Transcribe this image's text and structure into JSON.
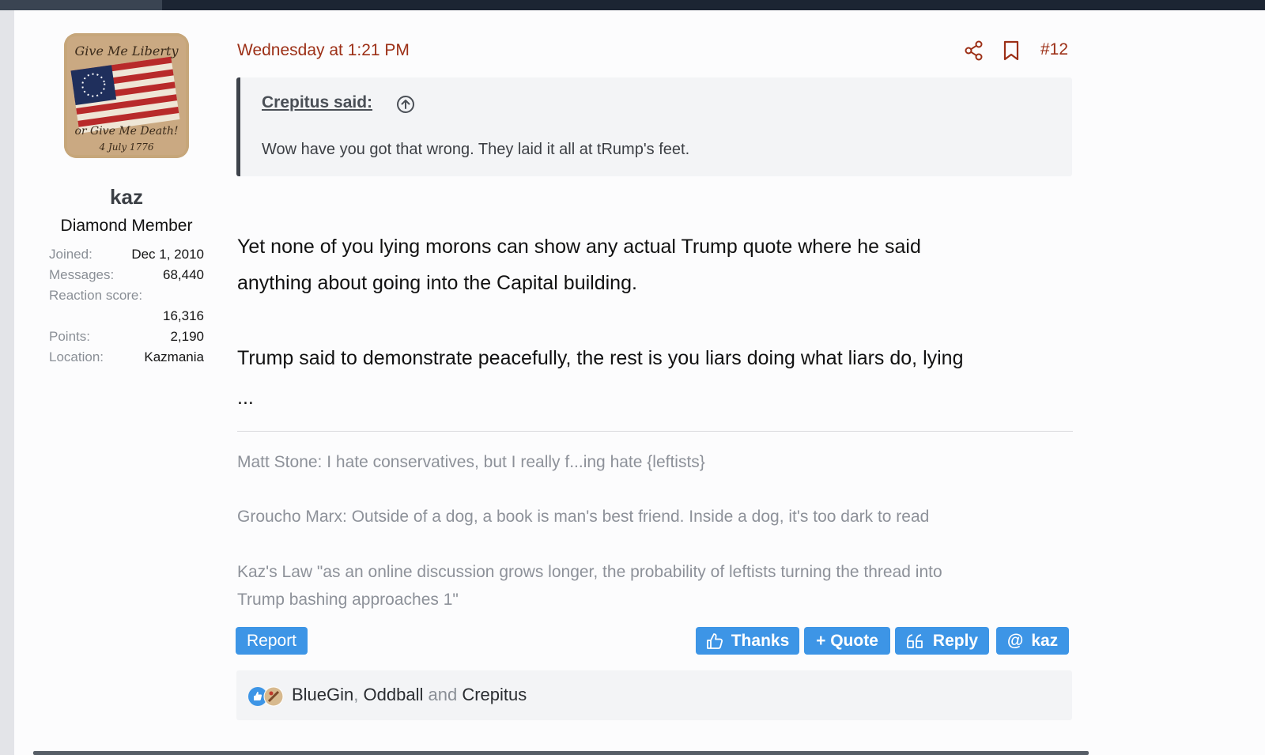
{
  "user": {
    "name": "kaz",
    "title": "Diamond Member",
    "avatar_text_top": "Give Me Liberty",
    "avatar_text_bottom": "or Give Me Death!",
    "avatar_date": "4 July 1776",
    "stats": [
      {
        "label": "Joined:",
        "value": "Dec 1, 2010"
      },
      {
        "label": "Messages:",
        "value": "68,440"
      },
      {
        "label": "Reaction score:",
        "value": "16,316"
      },
      {
        "label": "Points:",
        "value": "2,190"
      },
      {
        "label": "Location:",
        "value": "Kazmania"
      }
    ]
  },
  "post": {
    "date": "Wednesday at 1:21 PM",
    "number": "#12",
    "icons": {
      "share": "share-icon",
      "bookmark": "bookmark-icon"
    },
    "quote": {
      "attribution": "Crepitus said:",
      "text": "Wow have you got that wrong. They laid it all at tRump's feet."
    },
    "body": [
      "Yet none of you lying morons can show any actual Trump quote where he said",
      "anything about going into the Capital building.",
      "Trump said to demonstrate peacefully, the rest is you liars doing what liars do, lying",
      "..."
    ],
    "signature": [
      "Matt Stone: I hate conservatives, but I really f...ing hate {leftists}",
      "Groucho Marx: Outside of a dog, a book is man's best friend. Inside a dog, it's too dark to read",
      "Kaz's Law \"as an online discussion grows longer, the probability of leftists turning the thread into",
      "Trump bashing approaches 1\""
    ]
  },
  "actions": {
    "report": "Report",
    "thanks": "Thanks",
    "quote": "+ Quote",
    "reply": "Reply",
    "mention": "kaz"
  },
  "reactions": {
    "users": [
      "BlueGin",
      "Oddball",
      "Crepitus"
    ],
    "comma": ",",
    "and": "and"
  },
  "colors": {
    "accent": "#9c2f16",
    "button": "#3d95e6",
    "topbar": "#1c2533"
  }
}
